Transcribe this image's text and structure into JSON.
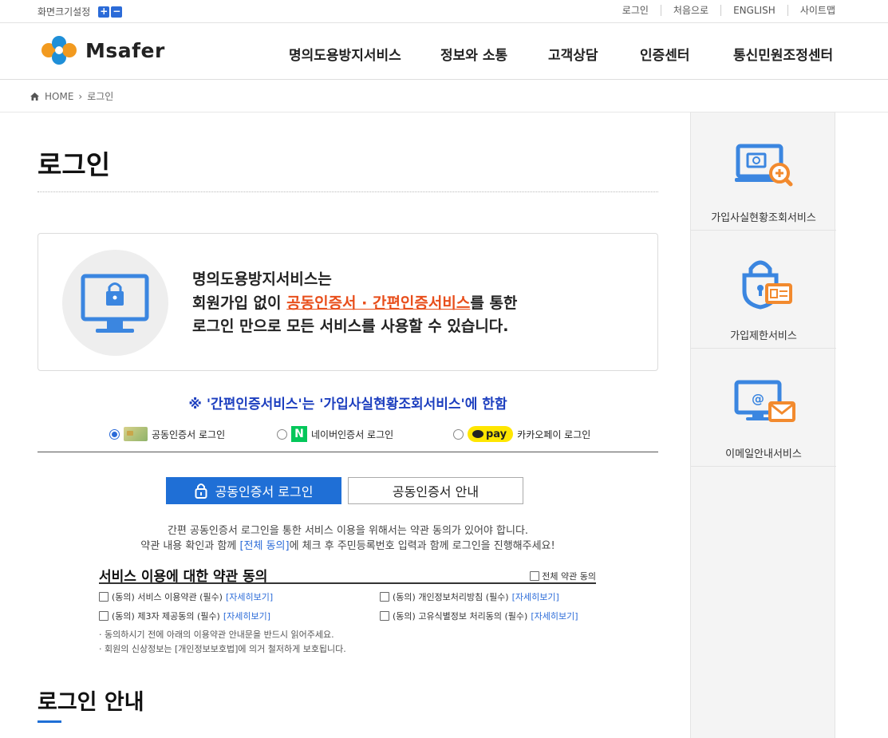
{
  "topbar": {
    "font_size_label": "화면크기설정",
    "font_plus": "+",
    "font_minus": "−",
    "links": [
      "로그인",
      "처음으로",
      "ENGLISH",
      "사이트맵"
    ]
  },
  "header": {
    "logo_text": "Msafer",
    "nav": [
      "명의도용방지서비스",
      "정보와 소통",
      "고객상담",
      "인증센터",
      "통신민원조정센터"
    ]
  },
  "breadcrumb": {
    "home": "HOME",
    "current": "로그인"
  },
  "page_title": "로그인",
  "info": {
    "line1": "명의도용방지서비스는",
    "line2_pre": "회원가입 없이 ",
    "line2_highlight": "공동인증서 · 간편인증서비스",
    "line2_post": "를 통한",
    "line3": "로그인 만으로 모든 서비스를 사용할 수 있습니다."
  },
  "notice": "※ '간편인증서비스'는 '가입사실현황조회서비스'에 한함",
  "login_types": {
    "selected": "공동인증서 로그인",
    "options": [
      {
        "label": "공동인증서 로그인"
      },
      {
        "label": "네이버인증서 로그인",
        "badge": "N"
      },
      {
        "label": "카카오페이 로그인",
        "badge": "pay"
      }
    ]
  },
  "tabs": {
    "active": "공동인증서 로그인",
    "inactive": "공동인증서 안내"
  },
  "description": {
    "line1": "간편 공동인증서 로그인을 통한 서비스 이용을 위해서는 약관 동의가 있어야 합니다.",
    "line2_pre": "약관 내용 확인과 함께 ",
    "line2_link": "[전체 동의]",
    "line2_post": "에 체크 후 주민등록번호 입력과 함께 로그인을 진행해주세요!"
  },
  "terms": {
    "title": "서비스 이용에 대한 약관 동의",
    "all_agree": "전체 약관 동의",
    "detail_link": "[자세히보기]",
    "items": [
      "(동의) 서비스 이용약관 (필수)",
      "(동의) 개인정보처리방침 (필수)",
      "(동의) 제3자 제공동의 (필수)",
      "(동의) 고유식별정보 처리동의 (필수)"
    ],
    "notes": [
      "· 동의하시기 전에 아래의 이용약관 안내문을 반드시 읽어주세요.",
      "· 회원의 신상정보는 [개인정보보호법]에 의거 철저하게 보호됩니다."
    ]
  },
  "sub_title": "로그인 안내",
  "quick_menu": [
    {
      "label": "가입사실현황조회서비스",
      "icon": "monitor-search-icon"
    },
    {
      "label": "가입제한서비스",
      "icon": "lock-card-icon"
    },
    {
      "label": "이메일안내서비스",
      "icon": "monitor-mail-icon"
    }
  ],
  "colors": {
    "primary": "#1f6fd6",
    "highlight": "#e84e1b",
    "notice": "#1d3fbf"
  }
}
